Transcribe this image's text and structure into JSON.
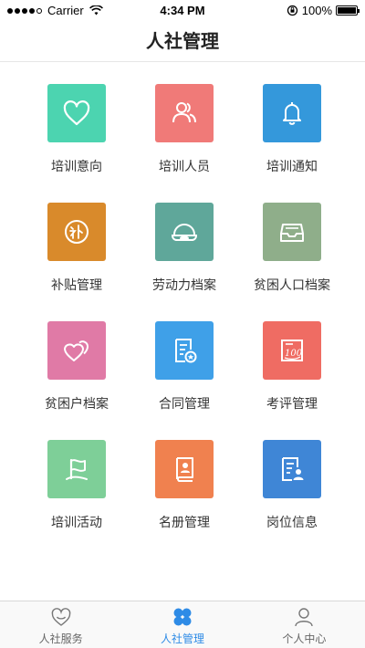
{
  "status_bar": {
    "carrier": "Carrier",
    "time": "4:34 PM",
    "battery": "100%"
  },
  "nav": {
    "title": "人社管理"
  },
  "tiles": [
    {
      "label": "培训意向",
      "icon": "heart-icon",
      "color": "#4cd4b0"
    },
    {
      "label": "培训人员",
      "icon": "people-icon",
      "color": "#f07a78"
    },
    {
      "label": "培训通知",
      "icon": "bell-icon",
      "color": "#3498db"
    },
    {
      "label": "补贴管理",
      "icon": "subsidy-icon",
      "color": "#d98a2b"
    },
    {
      "label": "劳动力档案",
      "icon": "helmet-icon",
      "color": "#5fa79a"
    },
    {
      "label": "贫困人口档案",
      "icon": "archive-box-icon",
      "color": "#8fae8a"
    },
    {
      "label": "贫困户档案",
      "icon": "double-heart-icon",
      "color": "#e07aa6"
    },
    {
      "label": "合同管理",
      "icon": "contract-icon",
      "color": "#3fa0e8"
    },
    {
      "label": "考评管理",
      "icon": "score-sheet-icon",
      "color": "#ef6c63"
    },
    {
      "label": "培训活动",
      "icon": "flag-icon",
      "color": "#7ecf98"
    },
    {
      "label": "名册管理",
      "icon": "roster-book-icon",
      "color": "#f0814f"
    },
    {
      "label": "岗位信息",
      "icon": "job-card-icon",
      "color": "#3f86d6"
    }
  ],
  "tab_bar": {
    "tabs": [
      {
        "label": "人社服务",
        "icon": "heart-outline-icon",
        "active": false
      },
      {
        "label": "人社管理",
        "icon": "clover-icon",
        "active": true
      },
      {
        "label": "个人中心",
        "icon": "person-icon",
        "active": false
      }
    ],
    "active_color": "#2e8be6"
  }
}
